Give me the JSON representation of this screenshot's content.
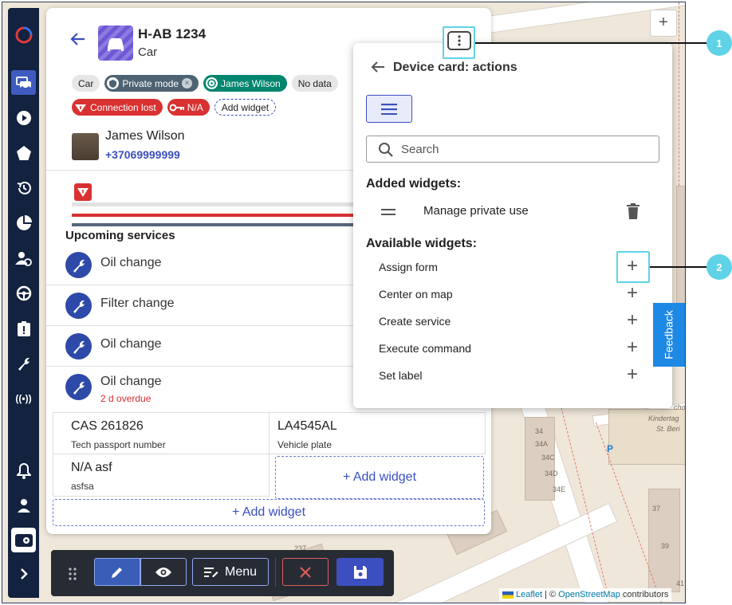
{
  "vehicle": {
    "plate": "H-AB 1234",
    "type": "Car"
  },
  "tags": {
    "car": "Car",
    "private_mode": "Private mode",
    "driver": "James Wilson",
    "no_data": "No data",
    "connection_lost": "Connection lost",
    "ignition": "N/A",
    "add_widget": "Add widget"
  },
  "driver": {
    "name": "James Wilson",
    "phone": "+37069999999"
  },
  "upcoming": {
    "title": "Upcoming services",
    "items": [
      {
        "name": "Oil change",
        "overdue": ""
      },
      {
        "name": "Filter change",
        "overdue": ""
      },
      {
        "name": "Oil change",
        "overdue": ""
      },
      {
        "name": "Oil change",
        "overdue": "2 d overdue"
      }
    ]
  },
  "fields": [
    {
      "value": "CAS 261826",
      "label": "Tech passport number"
    },
    {
      "value": "LA4545AL",
      "label": "Vehicle plate"
    },
    {
      "value": "N/A asf",
      "label": "asfsa"
    }
  ],
  "add_widget_cell": "+ Add widget",
  "add_widget_bottom": "+ Add widget",
  "popup": {
    "title": "Device card: actions",
    "search_placeholder": "Search",
    "added_title": "Added widgets:",
    "added": [
      "Manage private use"
    ],
    "available_title": "Available widgets:",
    "available": [
      "Assign form",
      "Center on map",
      "Create service",
      "Execute command",
      "Set label"
    ]
  },
  "callouts": [
    "1",
    "2"
  ],
  "feedback": "Feedback",
  "toolbar": {
    "menu_label": "Menu"
  },
  "map": {
    "attribution_leaflet": "Leaflet",
    "attribution_sep": " | © ",
    "attribution_osm": "OpenStreetMap",
    "attribution_tail": " contributors",
    "labels": [
      "34",
      "34A",
      "34C",
      "34D",
      "34E",
      "237",
      "37",
      "39",
      "41",
      "Kindertag",
      "St. Beri",
      "choi"
    ]
  },
  "colors": {
    "sidebar": "#12223f",
    "accent": "#3b4fc0",
    "callout": "#5fd2e6",
    "danger": "#d93131",
    "teal": "#00856f"
  }
}
